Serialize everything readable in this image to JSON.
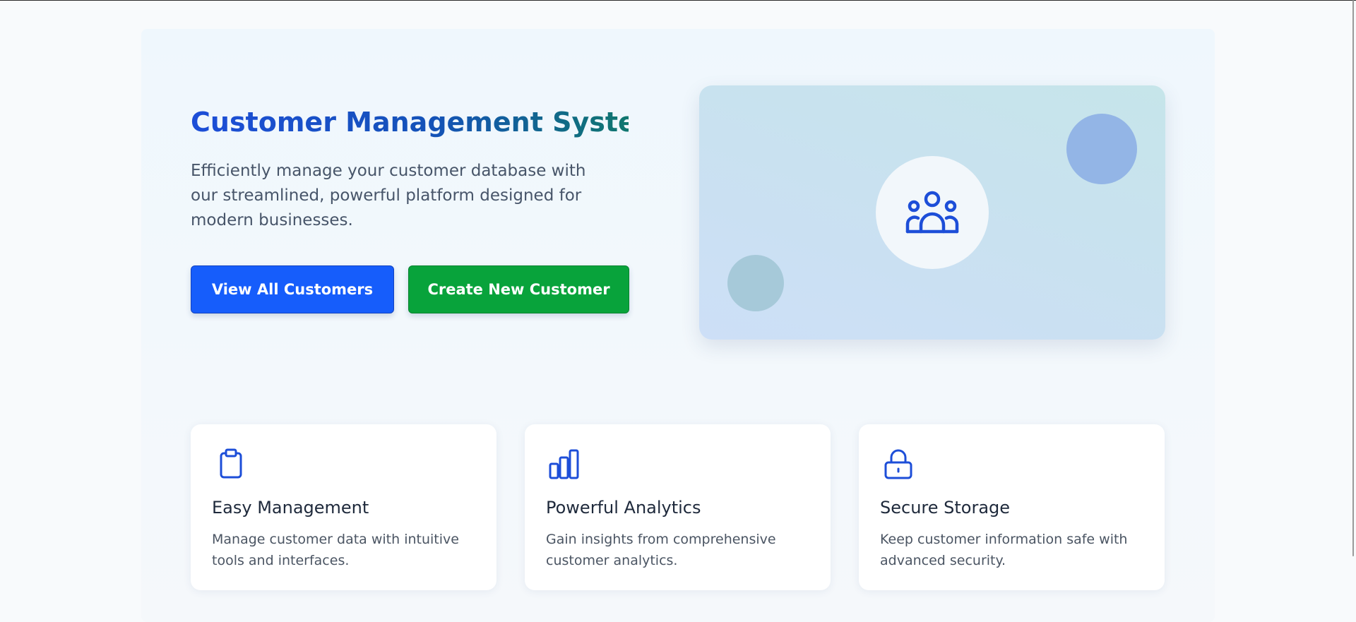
{
  "hero": {
    "title": "Customer Management System",
    "subtitle": "Efficiently manage your customer database with our streamlined, powerful platform designed for modern businesses.",
    "primary_button": "View All Customers",
    "secondary_button": "Create New Customer",
    "illustration_icon": "users-group-icon"
  },
  "features": [
    {
      "icon": "clipboard-icon",
      "title": "Easy Management",
      "description": "Manage customer data with intuitive tools and interfaces."
    },
    {
      "icon": "bar-chart-icon",
      "title": "Powerful Analytics",
      "description": "Gain insights from comprehensive customer analytics."
    },
    {
      "icon": "lock-icon",
      "title": "Secure Storage",
      "description": "Keep customer information safe with advanced security."
    }
  ],
  "colors": {
    "primary": "#165dfb",
    "success": "#08a33b",
    "icon": "#1d4ed8",
    "title_gradient_start": "#1d4ed8",
    "title_gradient_end": "#0f766e"
  }
}
